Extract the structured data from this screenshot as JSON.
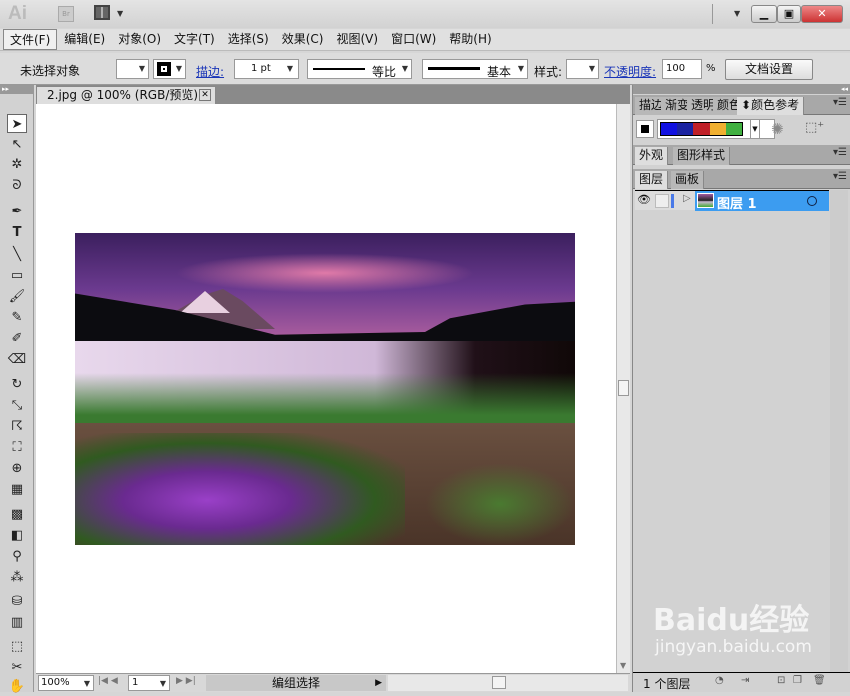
{
  "app": {
    "logo": "Ai",
    "bridge": "Br"
  },
  "menu": [
    "文件(F)",
    "编辑(E)",
    "对象(O)",
    "文字(T)",
    "选择(S)",
    "效果(C)",
    "视图(V)",
    "窗口(W)",
    "帮助(H)"
  ],
  "control": {
    "selection": "未选择对象",
    "stroke_label": "描边:",
    "stroke_weight": "1 pt",
    "profile": "等比",
    "brush": "基本",
    "style_label": "样式:",
    "opacity_label": "不透明度:",
    "opacity": "100",
    "percent": "%",
    "doc_setup": "文档设置"
  },
  "document": {
    "tab": "2.jpg @ 100% (RGB/预览)"
  },
  "status": {
    "zoom": "100%",
    "artboard": "1",
    "mode": "编组选择"
  },
  "panels": {
    "color_tabs": [
      "描边",
      "渐变",
      "透明",
      "颜色",
      "颜色参考"
    ],
    "swatches": [
      "#1010e0",
      "#1a22a0",
      "#c02028",
      "#f0b030",
      "#40b040"
    ],
    "appearance_tabs": [
      "外观",
      "图形样式"
    ],
    "layer_tabs": [
      "图层",
      "画板"
    ],
    "layers": [
      {
        "name": "图层 1"
      }
    ],
    "layer_count": "1 个图层"
  },
  "watermark": {
    "brand": "Baidu经验",
    "url": "jingyan.baidu.com"
  }
}
